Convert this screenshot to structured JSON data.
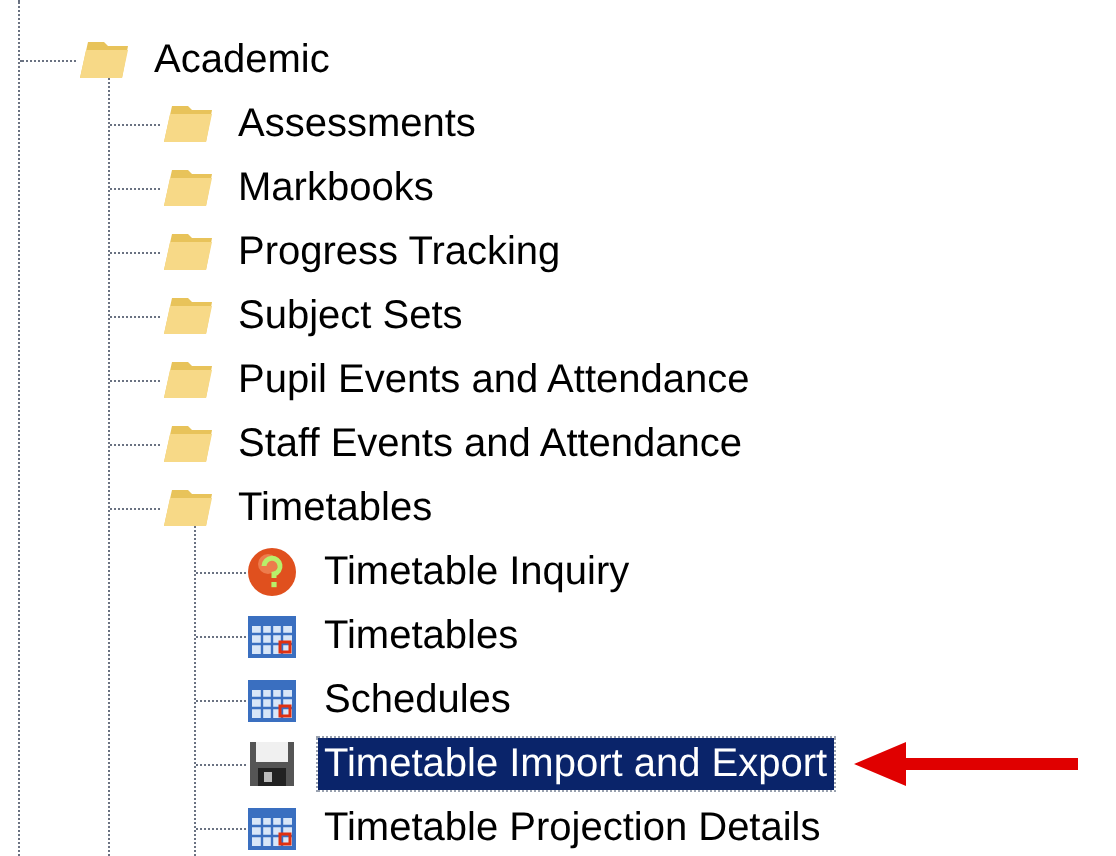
{
  "tree": [
    {
      "label": "Academic",
      "kind": "folder",
      "selected": false,
      "children": [
        {
          "label": "Assessments",
          "kind": "folder",
          "selected": false
        },
        {
          "label": "Markbooks",
          "kind": "folder",
          "selected": false
        },
        {
          "label": "Progress Tracking",
          "kind": "folder",
          "selected": false
        },
        {
          "label": "Subject Sets",
          "kind": "folder",
          "selected": false
        },
        {
          "label": "Pupil Events and Attendance",
          "kind": "folder",
          "selected": false
        },
        {
          "label": "Staff Events and Attendance",
          "kind": "folder",
          "selected": false
        },
        {
          "label": "Timetables",
          "kind": "folder",
          "selected": false,
          "children": [
            {
              "label": "Timetable Inquiry",
              "kind": "help",
              "selected": false
            },
            {
              "label": "Timetables",
              "kind": "calendar",
              "selected": false
            },
            {
              "label": "Schedules",
              "kind": "calendar",
              "selected": false
            },
            {
              "label": "Timetable Import and Export",
              "kind": "disk",
              "selected": true
            },
            {
              "label": "Timetable Projection Details",
              "kind": "calendar",
              "selected": false
            }
          ]
        }
      ]
    }
  ],
  "annotation": {
    "kind": "arrow"
  }
}
